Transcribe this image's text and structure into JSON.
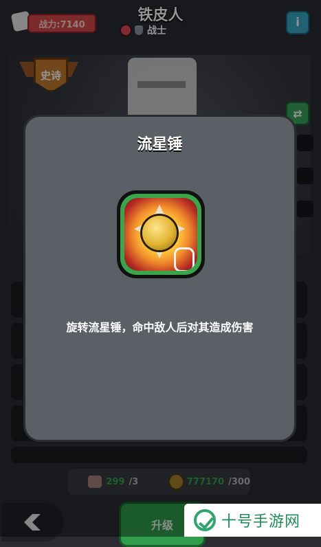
{
  "header": {
    "power_label": "战力:7140",
    "hero_name": "铁皮人",
    "hero_class": "战士",
    "info_label": "i"
  },
  "hero": {
    "rarity": "史诗"
  },
  "resources": {
    "fragments_current": "299",
    "fragments_required": "/3",
    "coins_current": "777170",
    "coins_required": "/300"
  },
  "actions": {
    "upgrade_label": "升级"
  },
  "skill_modal": {
    "title": "流星锤",
    "description": "旋转流星锤，命中敌人后对其造成伤害"
  },
  "watermark": {
    "text": "十号手游网"
  },
  "colors": {
    "accent_green": "#2f9d4a",
    "power_red": "#d44a4a",
    "info_blue": "#38a9c4",
    "epic_orange": "#c57a2e"
  }
}
